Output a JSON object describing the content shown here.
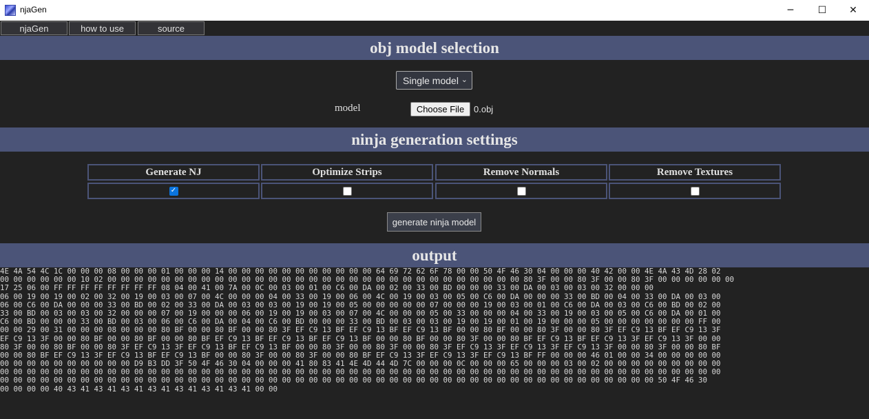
{
  "window": {
    "title": "njaGen",
    "minimize_glyph": "─",
    "maximize_glyph": "☐",
    "close_glyph": "✕"
  },
  "nav": [
    "njaGen",
    "how to use",
    "source"
  ],
  "sections": {
    "obj": "obj model selection",
    "ninja": "ninja generation settings",
    "output": "output"
  },
  "model_select": {
    "selected": "Single model"
  },
  "model_field": {
    "label": "model",
    "button": "Choose File",
    "filename": "0.obj"
  },
  "settings": [
    {
      "label": "Generate NJ",
      "checked": true
    },
    {
      "label": "Optimize Strips",
      "checked": false
    },
    {
      "label": "Remove Normals",
      "checked": false
    },
    {
      "label": "Remove Textures",
      "checked": false
    }
  ],
  "generate_button": "generate ninja model",
  "output_lines": [
    "4E 4A 54 4C 1C 00 00 00 08 00 00 00 01 00 00 00 14 00 00 00 00 00 00 00 00 00 00 00 64 69 72 62 6F 78 00 00 50 4F 46 30 04 00 00 00 40 42 00 00 4E 4A 43 4D 28 02",
    "00 00 00 00 00 00 10 02 00 00 00 00 00 00 00 00 00 00 00 00 00 00 00 00 00 00 00 00 00 00 00 00 00 00 00 00 00 00 00 80 3F 00 00 80 3F 00 00 80 3F 00 00 00 00 00 00",
    "17 25 06 00 FF FF FF FF FF FF FF FF 08 04 00 41 00 7A 00 0C 00 03 00 01 00 C6 00 DA 00 02 00 33 00 BD 00 00 00 33 00 DA 00 03 00 03 00 32 00 00 00",
    "06 00 19 00 19 00 02 00 32 00 19 00 03 00 07 00 4C 00 00 00 04 00 33 00 19 00 06 00 4C 00 19 00 03 00 05 00 C6 00 DA 00 00 00 33 00 BD 00 04 00 33 00 DA 00 03 00",
    "06 00 C6 00 DA 00 00 00 33 00 BD 00 02 00 33 00 DA 00 03 00 03 00 19 00 19 00 05 00 00 00 00 00 07 00 00 00 19 00 03 00 01 00 C6 00 DA 00 03 00 C6 00 BD 00 02 00",
    "33 00 BD 00 03 00 03 00 32 00 00 00 07 00 19 00 00 00 06 00 19 00 19 00 03 00 07 00 4C 00 00 00 05 00 33 00 00 00 04 00 33 00 19 00 03 00 05 00 C6 00 DA 00 01 00",
    "C6 00 BD 00 00 00 33 00 BD 00 03 00 06 00 C6 00 DA 00 04 00 C6 00 BD 00 00 00 33 00 BD 00 03 00 03 00 19 00 19 00 01 00 19 00 00 00 05 00 00 00 00 00 00 00 FF 00",
    "00 00 29 00 31 00 00 00 08 00 00 00 80 BF 00 00 80 BF 00 00 80 3F EF C9 13 BF EF C9 13 BF EF C9 13 BF 00 00 80 BF 00 00 80 3F 00 00 80 3F EF C9 13 BF EF C9 13 3F",
    "EF C9 13 3F 00 00 80 BF 00 00 80 BF 00 00 80 BF EF C9 13 BF EF C9 13 BF EF C9 13 BF 00 00 80 BF 00 00 80 3F 00 00 80 BF EF C9 13 BF EF C9 13 3F EF C9 13 3F 00 00",
    "80 3F 00 00 80 BF 00 00 80 3F EF C9 13 3F EF C9 13 BF EF C9 13 BF 00 00 80 3F 00 00 80 3F 00 00 80 3F EF C9 13 3F EF C9 13 3F EF C9 13 3F 00 00 80 3F 00 00 80 BF",
    "00 00 80 BF EF C9 13 3F EF C9 13 BF EF C9 13 BF 00 00 80 3F 00 00 80 3F 00 00 80 BF EF C9 13 3F EF C9 13 3F EF C9 13 BF FF 00 00 00 46 01 00 00 34 00 00 00 00 00",
    "00 00 00 00 00 00 00 00 00 00 D9 B3 DD 3F 50 4F 46 30 04 00 00 00 41 80 83 41 4E 4D 44 4D 7C 00 00 00 0C 00 00 00 65 00 00 00 03 00 02 00 00 00 00 00 00 00 00 00",
    "00 00 00 00 00 00 00 00 00 00 00 00 00 00 00 00 00 00 00 00 00 00 00 00 00 00 00 00 00 00 00 00 00 00 00 00 00 00 00 00 00 00 00 00 00 00 00 00 00 00 00 00 00 00",
    "00 00 00 00 00 00 00 00 00 00 00 00 00 00 00 00 00 00 00 00 00 00 00 00 00 00 00 00 00 00 00 00 00 00 00 00 00 00 00 00 00 00 00 00 00 00 00 00 00 50 4F 46 30",
    "00 00 00 00 40 43 41 43 41 43 41 43 41 43 41 43 41 43 41 00 00"
  ]
}
